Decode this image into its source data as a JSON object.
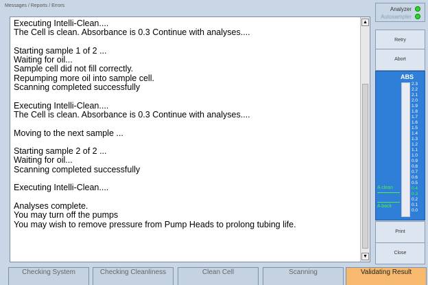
{
  "messages": {
    "title": "Messages / Reports / Errors",
    "lines": [
      "Executing Intelli-Clean....",
      "The Cell is clean. Absorbance is 0.3 Continue with analyses....",
      "",
      "Starting sample 1 of 2 ...",
      "Waiting for oil...",
      "Sample cell did not fill correctly.",
      "Repumping more oil into sample cell.",
      "Scanning completed successfully",
      "",
      "Executing Intelli-Clean....",
      "The Cell is clean. Absorbance is 0.3 Continue with analyses....",
      "",
      "Moving to the next sample ...",
      "",
      "Starting sample 2 of 2 ...",
      "Waiting for oil...",
      "Scanning completed successfully",
      "",
      "Executing Intelli-Clean....",
      "",
      "Analyses complete.",
      "You may turn off the pumps",
      "You may wish to remove pressure from Pump Heads to prolong tubing life."
    ]
  },
  "status": {
    "analyzer_label": "Analyzer",
    "autosampler_label": "Autosampler",
    "indicator_color": "#22dd22"
  },
  "buttons": {
    "retry": "Retry",
    "abort": "Abort",
    "print": "Print",
    "close": "Close"
  },
  "gauge": {
    "label": "ABS",
    "ticks": [
      "2.3",
      "2.2",
      "2.1",
      "2.0",
      "1.9",
      "1.8",
      "1.7",
      "1.6",
      "1.5",
      "1.4",
      "1.3",
      "1.2",
      "1.1",
      "1.0",
      "0.9",
      "0.8",
      "0.7",
      "0.6",
      "0.5",
      "0.4",
      "0.3",
      "0.2",
      "0.1",
      "0.0"
    ],
    "highlight_ticks": [
      "0.4",
      "0.3"
    ],
    "clean_label": "A clean",
    "back_label": "A back",
    "color": "#2f7fd8"
  },
  "tabs": [
    {
      "label": "Checking System",
      "active": false
    },
    {
      "label": "Checking Cleanliness",
      "active": false
    },
    {
      "label": "Clean Cell",
      "active": false
    },
    {
      "label": "Scanning",
      "active": false
    },
    {
      "label": "Validating Result",
      "active": true
    }
  ],
  "active_tab_color": "#f6b96e"
}
